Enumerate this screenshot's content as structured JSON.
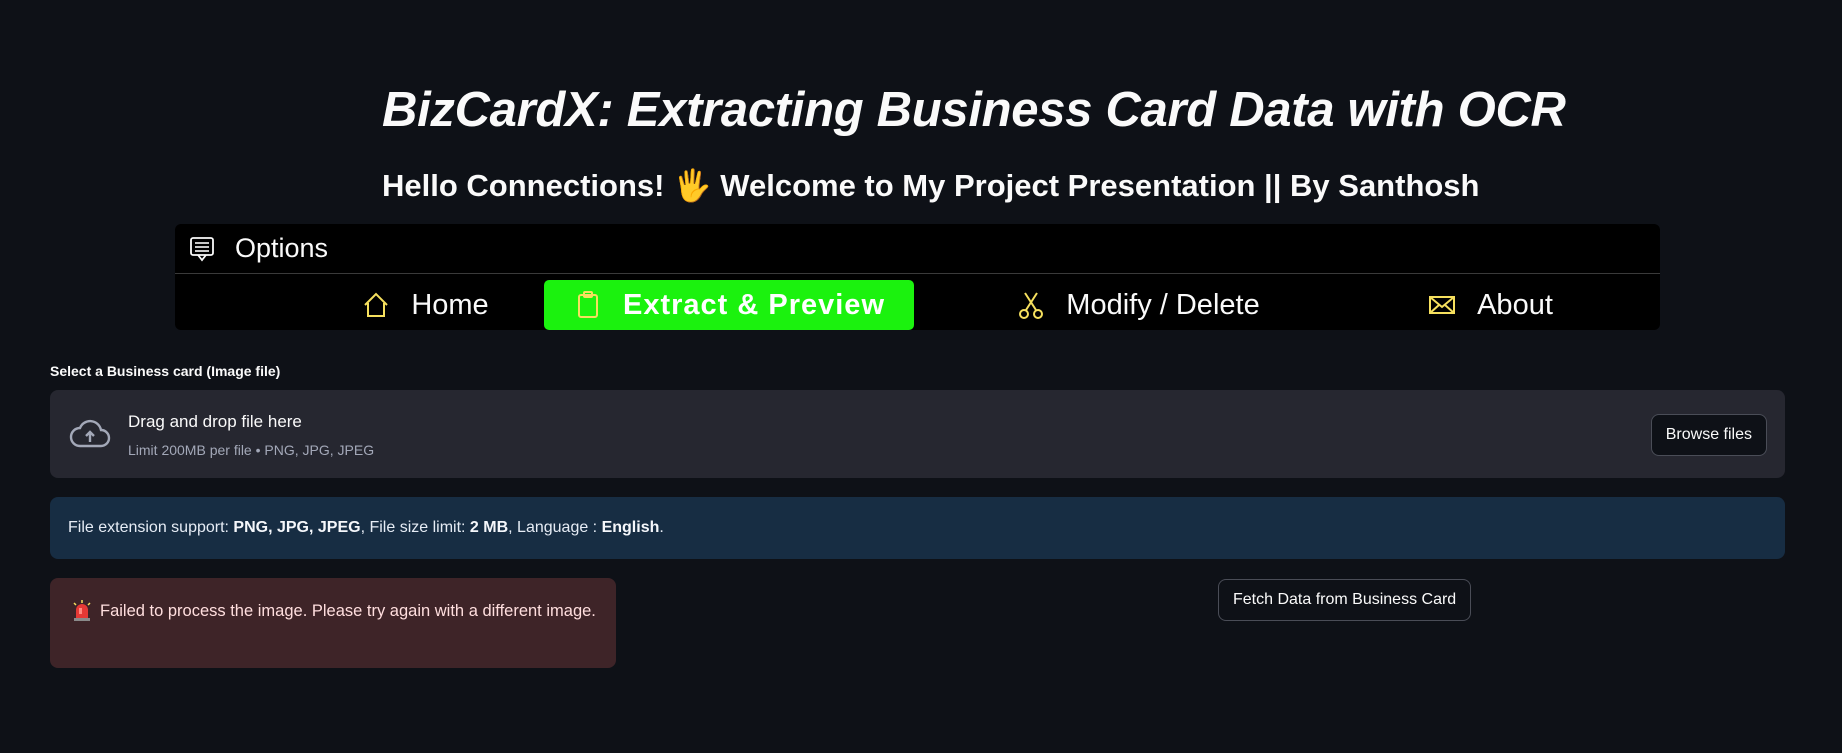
{
  "header": {
    "title": "BizCardX: Extracting Business Card Data with OCR",
    "subtitle": "Hello Connections! 🖐 Welcome to My Project Presentation || By Santhosh"
  },
  "menu": {
    "header_label": "Options",
    "header_icon": "menu-card-icon",
    "items": [
      {
        "label": "Home",
        "icon": "house-icon",
        "active": false
      },
      {
        "label": "Extract & Preview",
        "icon": "clipboard-icon",
        "active": true
      },
      {
        "label": "Modify / Delete",
        "icon": "scissors-icon",
        "active": false
      },
      {
        "label": "About",
        "icon": "envelope-icon",
        "active": false
      }
    ],
    "active_color": "#1bf20e",
    "icon_color": "#f6e05e"
  },
  "uploader": {
    "label": "Select a Business card (Image file)",
    "drop_text": "Drag and drop file here",
    "limit_text": "Limit 200MB per file • PNG, JPG, JPEG",
    "browse_label": "Browse files"
  },
  "info": {
    "prefix": "File extension support: ",
    "formats": "PNG, JPG, JPEG",
    "size_prefix": ", File size limit: ",
    "size": "2 MB",
    "lang_prefix": ", Language : ",
    "language": "English",
    "suffix": "."
  },
  "error": {
    "icon": "🚨",
    "message": "Failed to process the image. Please try again with a different image."
  },
  "actions": {
    "fetch_label": "Fetch Data from Business Card"
  },
  "colors": {
    "background": "#0e1117",
    "info_bg": "#172d43",
    "error_bg": "#3e2428",
    "dropzone_bg": "#262730"
  }
}
